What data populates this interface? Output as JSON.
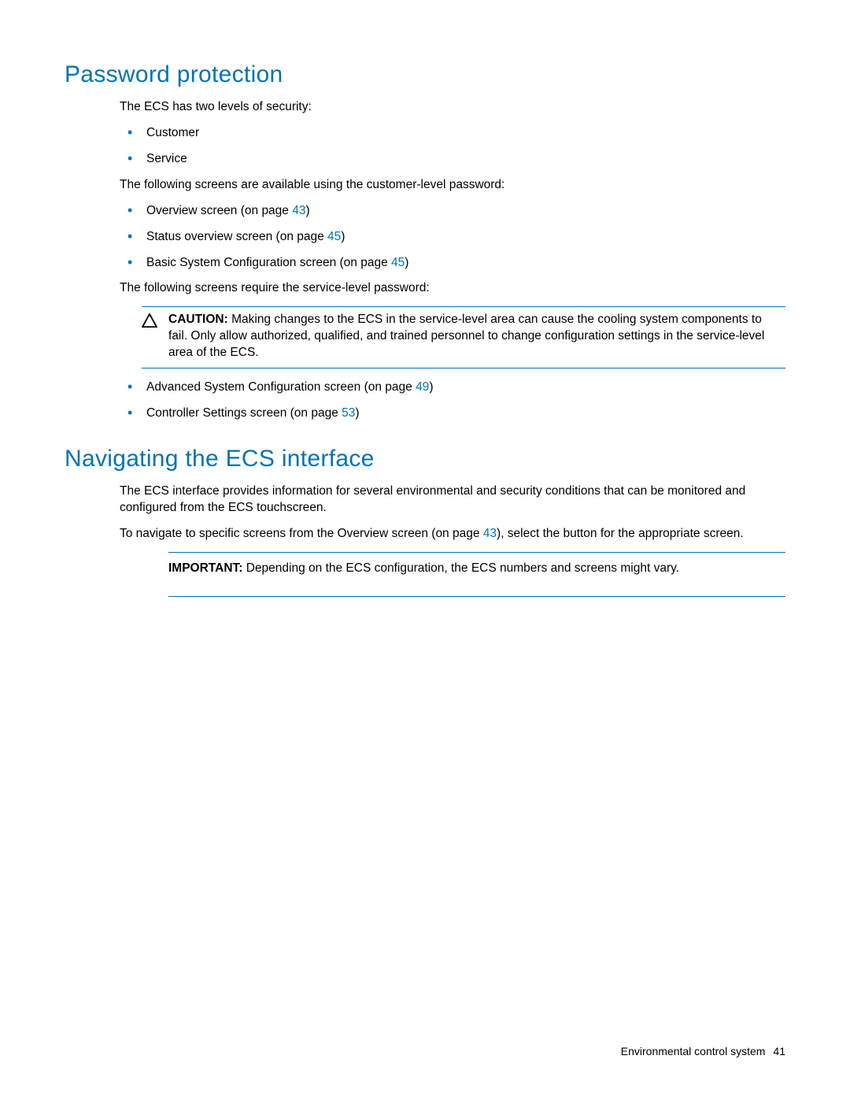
{
  "section1": {
    "heading": "Password protection",
    "intro": "The ECS has two levels of security:",
    "levels": [
      "Customer",
      "Service"
    ],
    "customer_intro": "The following screens are available using the customer-level password:",
    "customer_screens": [
      {
        "text_before": "Overview screen (on page ",
        "page": "43",
        "text_after": ")"
      },
      {
        "text_before": "Status overview screen (on page ",
        "page": "45",
        "text_after": ")"
      },
      {
        "text_before": "Basic System Configuration screen (on page ",
        "page": "45",
        "text_after": ")"
      }
    ],
    "service_intro": "The following screens require the service-level password:",
    "caution": {
      "label": "CAUTION:",
      "text": "  Making changes to the ECS in the service-level area can cause the cooling system components to fail. Only allow authorized, qualified, and trained personnel to change configuration settings in the service-level area of the ECS."
    },
    "service_screens": [
      {
        "text_before": "Advanced System Configuration screen (on page ",
        "page": "49",
        "text_after": ")"
      },
      {
        "text_before": "Controller Settings screen (on page ",
        "page": "53",
        "text_after": ")"
      }
    ]
  },
  "section2": {
    "heading": "Navigating the ECS interface",
    "para1": "The ECS interface provides information for several environmental and security conditions that can be monitored and configured from the ECS touchscreen.",
    "para2_before": "To navigate to specific screens from the Overview screen (on page ",
    "para2_page": "43",
    "para2_after": "), select the button for the appropriate screen.",
    "important": {
      "label": "IMPORTANT:",
      "text": "  Depending on the ECS configuration, the ECS numbers and screens might vary."
    }
  },
  "footer": {
    "title": "Environmental control system",
    "page": "41"
  }
}
